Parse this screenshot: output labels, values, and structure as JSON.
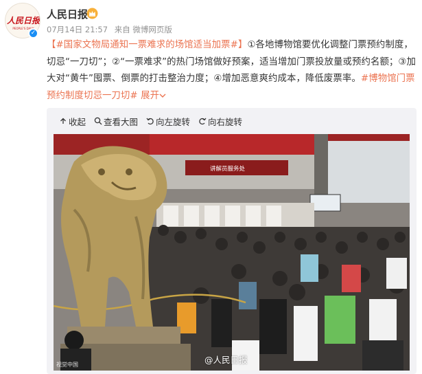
{
  "post": {
    "username": "人民日报",
    "timestamp": "07月14日 21:57",
    "source": "来自 微博网页版",
    "text": {
      "tag_open": "【#国家文物局通知一票难求的场馆适当加票#】",
      "body": "①各地博物馆要优化调整门票预约制度，切忌“一刀切”；②“一票难求”的热门场馆做好预案，适当增加门票投放量或预约名额；③加大对“黄牛”囤票、倒票的打击整治力度；④增加恶意爽约成本，降低废票率。",
      "tag_close": "#博物馆门票预约制度切忌一刀切#",
      "expand": "展开"
    }
  },
  "toolbar": {
    "collect": "收起",
    "view_large": "查看大图",
    "rotate_left": "向左旋转",
    "rotate_right": "向右旋转"
  },
  "photo": {
    "credit": "视觉中国",
    "watermark": "@人民日报",
    "banner_text": "讲解员服务处"
  },
  "avatar": {
    "logo_text": "人民日报",
    "logo_sub": "PEOPLE'S DAILY"
  },
  "colors": {
    "link": "#eb7350",
    "verified": "#1a8ef5",
    "logo_red": "#c8161d"
  }
}
